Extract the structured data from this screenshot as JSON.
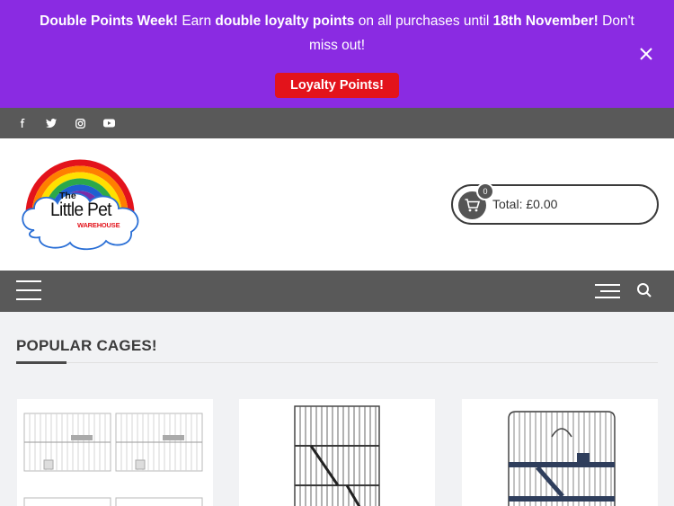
{
  "promo": {
    "title": "Double Points Week!",
    "text_1": "Earn",
    "highlight": "double loyalty points",
    "text_2": "on all purchases until",
    "date": "18th November!",
    "text_3": "Don't miss out!",
    "button_label": "Loyalty Points!"
  },
  "social": {
    "icons": [
      "facebook-icon",
      "twitter-icon",
      "instagram-icon",
      "youtube-icon"
    ]
  },
  "logo": {
    "line1": "The",
    "line2": "Little Pet",
    "line3": "WAREHOUSE"
  },
  "cart": {
    "count": "0",
    "total_label": "Total: £0.00"
  },
  "section": {
    "title": "POPULAR CAGES!"
  },
  "products": [
    {
      "name": "white-breeding-cages"
    },
    {
      "name": "tall-black-ferret-cage"
    },
    {
      "name": "black-multi-level-cage"
    }
  ],
  "colors": {
    "promo_bg": "#8a2be2",
    "promo_button": "#e3131b",
    "bar_bg": "#595959",
    "page_bg": "#f1f2f4"
  }
}
